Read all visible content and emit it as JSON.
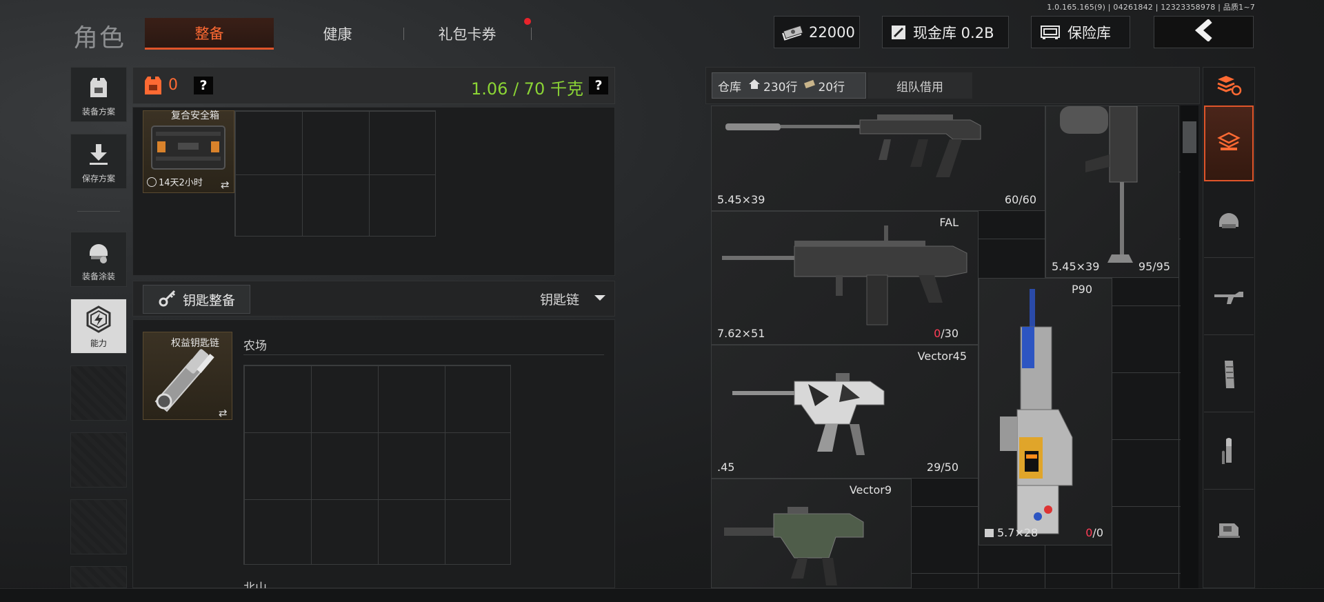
{
  "version": "1.0.165.165(9) | 04261842 | 12323358978 | 品质1~7",
  "header": {
    "title": "角色",
    "tabs": [
      {
        "label": "整备",
        "active": true
      },
      {
        "label": "健康",
        "active": false
      },
      {
        "label": "礼包卡券",
        "active": false,
        "notification": true
      }
    ],
    "money": "22000",
    "cash_vault": "现金库 0.2B",
    "safe_vault": "保险库",
    "back_icon": "chevron-left-icon"
  },
  "sidebar": {
    "items": [
      {
        "label": "装备方案",
        "icon": "vest-loadout-icon"
      },
      {
        "label": "保存方案",
        "icon": "download-icon"
      },
      {
        "label": "装备涂装",
        "icon": "helmet-paint-icon"
      },
      {
        "label": "能力",
        "icon": "ability-hexagon-icon",
        "active": true
      }
    ]
  },
  "loadout": {
    "armor_count": "0",
    "help": "?",
    "weight": "1.06 / 70 千克"
  },
  "secure_case": {
    "name": "复合安全箱",
    "timer": "14天2小时",
    "swap": "⇄"
  },
  "keys": {
    "button": "钥匙整备",
    "dropdown": "钥匙链",
    "keychain_name": "权益钥匙链",
    "swap": "⇄",
    "sections": [
      "农场",
      "北山"
    ]
  },
  "warehouse": {
    "tab_label": "仓库",
    "rows_a": "230行",
    "rows_b": "20行",
    "team_borrow": "组队借用",
    "items": [
      {
        "name": "",
        "caliber": "5.45×39",
        "ammo": "60/60",
        "ammo_empty": false
      },
      {
        "name": "",
        "caliber": "5.45×39",
        "ammo": "95/95",
        "ammo_empty": false
      },
      {
        "name": "FAL",
        "caliber": "7.62×51",
        "ammo_current": "0",
        "ammo_max": "/30",
        "ammo_empty": true
      },
      {
        "name": "P90",
        "caliber": "5.7×28",
        "ammo_current": "0",
        "ammo_max": "/0",
        "ammo_empty": true
      },
      {
        "name": "Vector45",
        "caliber": ".45",
        "ammo": "29/50",
        "ammo_empty": false
      },
      {
        "name": "Vector9",
        "caliber": "",
        "ammo": "",
        "ammo_empty": false
      }
    ]
  },
  "filters": [
    "sort-refresh-icon",
    "all-layers-icon",
    "helmet-icon",
    "rifle-icon",
    "magazine-icon",
    "ammo-icon",
    "scope-icon"
  ],
  "colors": {
    "accent": "#e0552a",
    "weight_ok": "#8bd435",
    "ammo_empty": "#ff3d57"
  }
}
